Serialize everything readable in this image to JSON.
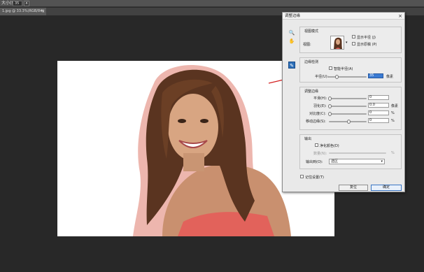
{
  "options_bar": {
    "label": "大小(S):",
    "value": "35",
    "checkbox_mark": "x"
  },
  "document_tab": {
    "title": "1.jpg @ 33.3%(RGB/8#)",
    "close": "×"
  },
  "dialog": {
    "title": "调整边缘",
    "close": "×",
    "view_mode": {
      "title": "视图模式",
      "view_label": "视图:",
      "show_radius": "显示半径 (J)",
      "show_original": "显示原稿 (P)"
    },
    "edge_detection": {
      "title": "边缘检测",
      "smart_radius": "智能半径(A)",
      "radius_label": "半径(U):",
      "radius_value": "35",
      "radius_unit": "像素"
    },
    "adjust_edge": {
      "title": "调整边缘",
      "rows": [
        {
          "label": "平滑(H):",
          "value": "0",
          "unit": ""
        },
        {
          "label": "羽化(E):",
          "value": "0.0",
          "unit": "像素"
        },
        {
          "label": "对比度(C):",
          "value": "0",
          "unit": "%"
        },
        {
          "label": "移动边缘(S):",
          "value": "0",
          "unit": "%"
        }
      ]
    },
    "output": {
      "title": "输出",
      "decontaminate": "净化颜色(D)",
      "amount_label": "数量(N):",
      "amount_unit": "%",
      "output_to_label": "输出到(O):",
      "output_to_value": "选区"
    },
    "remember": "记住设置(T)",
    "cancel": "复位",
    "ok": "确定"
  },
  "colors": {
    "arrow": "#d42020",
    "accent": "#2e6fb8"
  }
}
